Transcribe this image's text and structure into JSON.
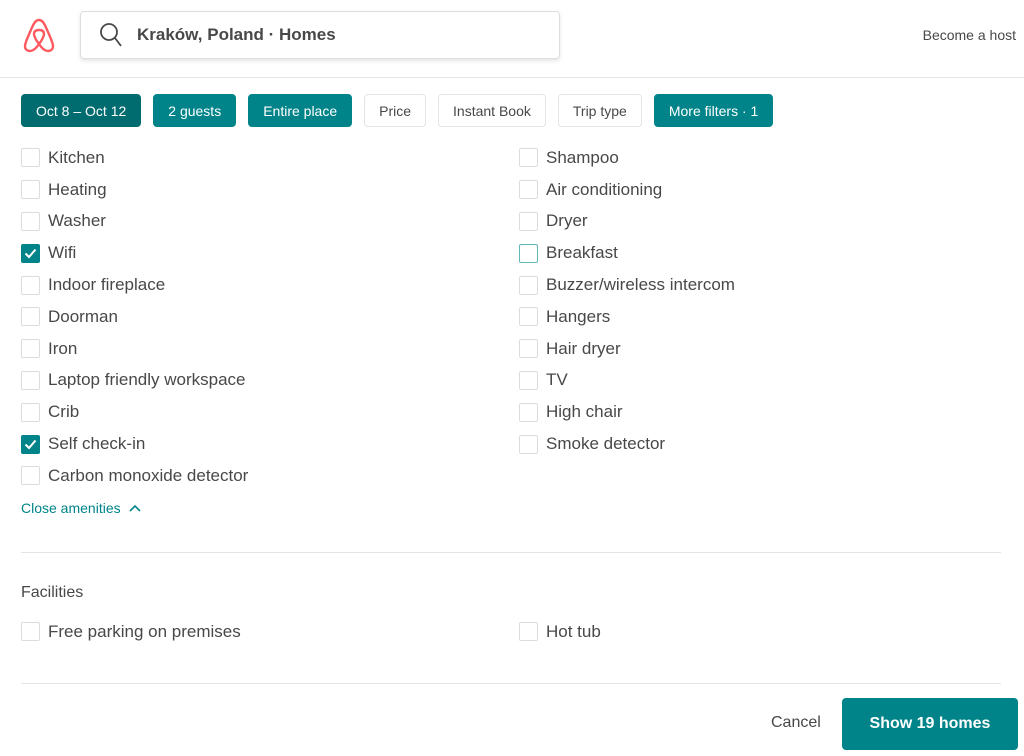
{
  "header": {
    "search_value": "Kraków, Poland · Homes",
    "become_host": "Become a host"
  },
  "chips": [
    {
      "label": "Oct 8 – Oct 12",
      "active": true,
      "dark": true
    },
    {
      "label": "2 guests",
      "active": true
    },
    {
      "label": "Entire place",
      "active": true
    },
    {
      "label": "Price",
      "active": false
    },
    {
      "label": "Instant Book",
      "active": false
    },
    {
      "label": "Trip type",
      "active": false
    },
    {
      "label": "More filters · 1",
      "active": true
    }
  ],
  "amenities": {
    "left": [
      {
        "label": "Kitchen",
        "checked": false
      },
      {
        "label": "Heating",
        "checked": false
      },
      {
        "label": "Washer",
        "checked": false
      },
      {
        "label": "Wifi",
        "checked": true
      },
      {
        "label": "Indoor fireplace",
        "checked": false
      },
      {
        "label": "Doorman",
        "checked": false
      },
      {
        "label": "Iron",
        "checked": false
      },
      {
        "label": "Laptop friendly workspace",
        "checked": false
      },
      {
        "label": "Crib",
        "checked": false
      },
      {
        "label": "Self check-in",
        "checked": true
      },
      {
        "label": "Carbon monoxide detector",
        "checked": false
      }
    ],
    "right": [
      {
        "label": "Shampoo",
        "checked": false
      },
      {
        "label": "Air conditioning",
        "checked": false
      },
      {
        "label": "Dryer",
        "checked": false
      },
      {
        "label": "Breakfast",
        "checked": false,
        "focused": true
      },
      {
        "label": "Buzzer/wireless intercom",
        "checked": false
      },
      {
        "label": "Hangers",
        "checked": false
      },
      {
        "label": "Hair dryer",
        "checked": false
      },
      {
        "label": "TV",
        "checked": false
      },
      {
        "label": "High chair",
        "checked": false
      },
      {
        "label": "Smoke detector",
        "checked": false
      }
    ],
    "close_label": "Close amenities"
  },
  "facilities": {
    "title": "Facilities",
    "left": [
      {
        "label": "Free parking on premises",
        "checked": false
      }
    ],
    "right": [
      {
        "label": "Hot tub",
        "checked": false
      }
    ]
  },
  "footer": {
    "cancel": "Cancel",
    "show": "Show 19 homes"
  },
  "colors": {
    "accent": "#008489",
    "brand": "#FF5A5F"
  }
}
